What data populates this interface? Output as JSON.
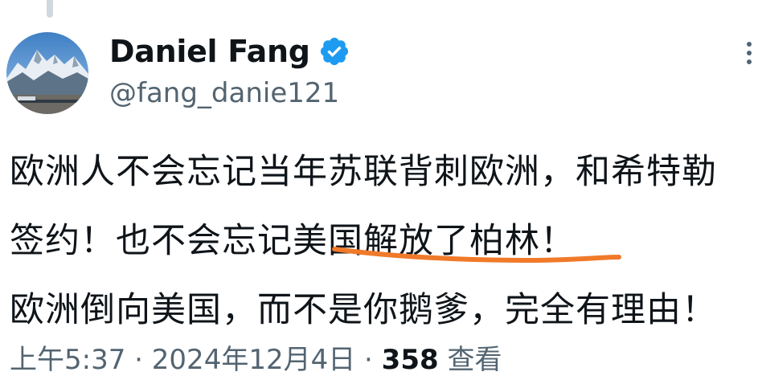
{
  "tweet": {
    "author": {
      "display_name": "Daniel Fang",
      "handle": "@fang_danie121",
      "verified": true,
      "avatar_icon": "mountain-landscape-avatar"
    },
    "text_lines": [
      "欧洲人不会忘记当年苏联背刺欧洲，和希特勒",
      "签约！也不会忘记美国解放了柏林！",
      "欧洲倒向美国，而不是你鹅爹，完全有理由！"
    ],
    "highlight": {
      "text": "美国解放了柏林",
      "color": "#f07a2a"
    },
    "meta": {
      "time": "上午5:37",
      "date": "2024年12月4日",
      "separator": "·",
      "views_count": "358",
      "views_label": "查看"
    }
  },
  "colors": {
    "verified_badge": "#1d9bf0",
    "text_primary": "#0f1419",
    "text_secondary": "#536471",
    "thread_line": "#cfd9de"
  },
  "icons": {
    "more": "more-dots-icon",
    "verified": "verified-badge-icon"
  }
}
